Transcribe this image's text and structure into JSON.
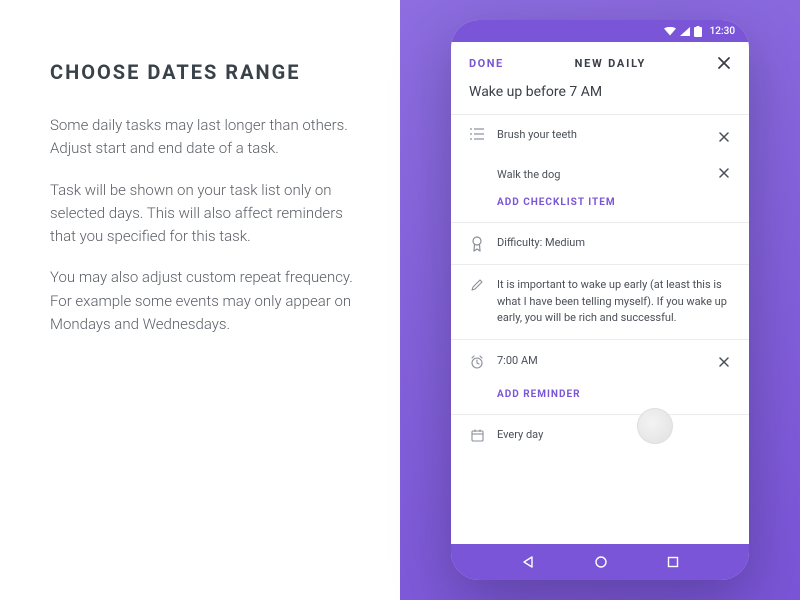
{
  "left": {
    "heading": "CHOOSE DATES RANGE",
    "p1": "Some daily tasks may last longer than others. Adjust start and end date of a task.",
    "p2": "Task will be shown on your task list only on selected days. This will also affect reminders that you specified for this task.",
    "p3": "You may also adjust custom repeat frequency. For example some events may only appear on Mondays and Wednesdays."
  },
  "statusbar": {
    "time": "12:30"
  },
  "appbar": {
    "done": "DONE",
    "title": "NEW DAILY"
  },
  "task": {
    "title": "Wake up before 7 AM"
  },
  "checklist": {
    "items": [
      "Brush your teeth",
      "Walk the dog"
    ],
    "add": "ADD CHECKLIST ITEM"
  },
  "difficulty": {
    "label": "Difficulty: Medium"
  },
  "note": {
    "text": "It is important to wake up early (at least this is what I have been telling myself). If you wake up early, you will be rich and successful."
  },
  "reminder": {
    "time": "7:00 AM",
    "add": "ADD REMINDER"
  },
  "repeat": {
    "freq": "Every day"
  }
}
